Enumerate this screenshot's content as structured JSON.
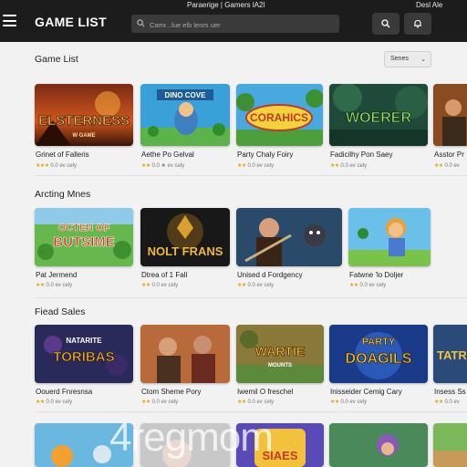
{
  "header": {
    "brand": "GAME LIST",
    "caption_left": "Paraerige | Gamers lA2l",
    "caption_right": "Desl Ale",
    "search_placeholder": "Camr...lue elb lenrs uer",
    "icons": [
      "menu-icon",
      "search-icon",
      "bell-icon"
    ]
  },
  "sort": {
    "label": "Senes",
    "icon": "chevron-down-icon"
  },
  "sections": [
    {
      "title": "Game List",
      "cards": [
        {
          "art": "ELSTERNESS",
          "art_sub": "W GAME",
          "title": "Grinet of Falleris",
          "stars": "★★★",
          "rating": "0.0 ev cely"
        },
        {
          "art": "DINO COVE",
          "title": "Aethe Po Gelval",
          "stars": "★★",
          "rating": "0.0 ★ ev cely"
        },
        {
          "art": "CORAHICS",
          "title": "Party Chaly Foiry",
          "stars": "★★",
          "rating": "0.0 ev cely"
        },
        {
          "art": "WOERER",
          "title": "Fadicilhy Pon Saey",
          "stars": "★★",
          "rating": "0.0 ev cely"
        },
        {
          "art": "",
          "title": "Asstor Pr",
          "stars": "★★",
          "rating": "0.0 ev"
        }
      ]
    },
    {
      "title": "Arcting Mnes",
      "cards": [
        {
          "art": "OCTEN OF",
          "art_sub": "BUTSIME",
          "title": "Pat Jermend",
          "stars": "★★",
          "rating": "0.0 ev cely"
        },
        {
          "art": "NOLT FRANS",
          "title": "Dtrea of 1 Fall",
          "stars": "★★",
          "rating": "0.0 ev cely"
        },
        {
          "art": "",
          "title": "Unised d Fordgency",
          "stars": "★★",
          "rating": "0.0 ev cely"
        },
        {
          "art": "",
          "title": "Fatwne 'lo Doljer",
          "stars": "★★",
          "rating": "0.0 ev cely"
        }
      ]
    },
    {
      "title": "Fiead Sales",
      "cards": [
        {
          "art": "NATARITE",
          "art_sub": "TORIBAS",
          "title": "Oouerd Fnresnsa",
          "stars": "★★",
          "rating": "0.0 ev cely"
        },
        {
          "art": "",
          "title": "Ctom Sheme Pory",
          "stars": "★★",
          "rating": "0.0 ev cely"
        },
        {
          "art": "WARTIE",
          "art_sub": "MOUNTS",
          "title": "Iwemil O freschel",
          "stars": "★★",
          "rating": "0.0 ev cely"
        },
        {
          "art": "PARTY",
          "art_sub": "DOAGILS",
          "title": "Inisseider Cemig Cary",
          "stars": "★★",
          "rating": "0.0 ev cely"
        },
        {
          "art": "TATR",
          "title": "Insess Ss",
          "stars": "★★",
          "rating": "0.0 ev"
        }
      ]
    },
    {
      "title": "",
      "cards": [
        {
          "art": ""
        },
        {
          "art": ""
        },
        {
          "art": "SIAES",
          "art_sub": ""
        },
        {
          "art": ""
        },
        {
          "art": ""
        }
      ]
    }
  ],
  "watermark": "4regmom",
  "colors": {
    "topbar": "#1c1c1c",
    "search_bg": "#3a3a3a",
    "page_bg": "#f2f2f2",
    "star": "#e0a41b"
  }
}
